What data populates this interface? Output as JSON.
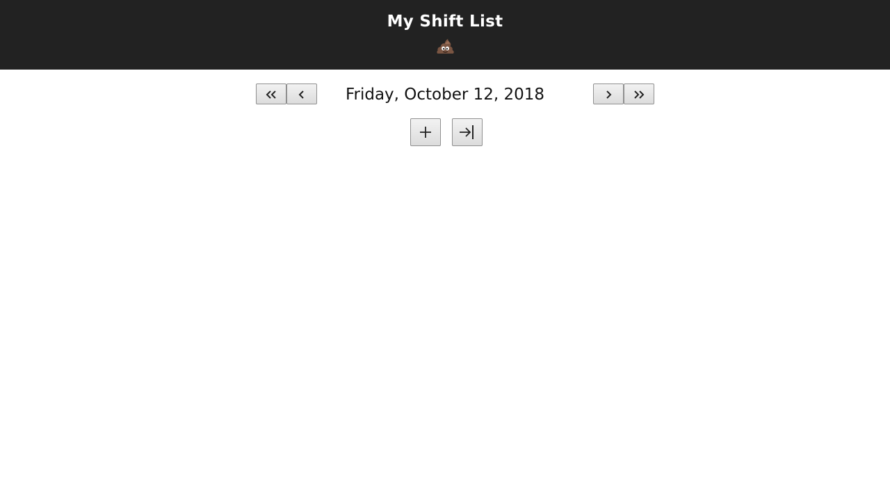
{
  "header": {
    "title": "My Shift List",
    "mascot_icon": "poop-emoji-icon",
    "background": "#222222"
  },
  "navigation": {
    "date": "Friday, October 12, 2018",
    "buttons": [
      {
        "name": "first-button",
        "icon": "double-chevron-left-icon"
      },
      {
        "name": "previous-button",
        "icon": "chevron-left-icon"
      },
      {
        "name": "next-button",
        "icon": "chevron-right-icon"
      },
      {
        "name": "last-button",
        "icon": "double-chevron-right-icon"
      }
    ]
  },
  "actions": {
    "buttons": [
      {
        "name": "add-shift-button",
        "icon": "plus-icon"
      },
      {
        "name": "jump-to-end-button",
        "icon": "arrow-right-to-bar-icon"
      }
    ]
  }
}
